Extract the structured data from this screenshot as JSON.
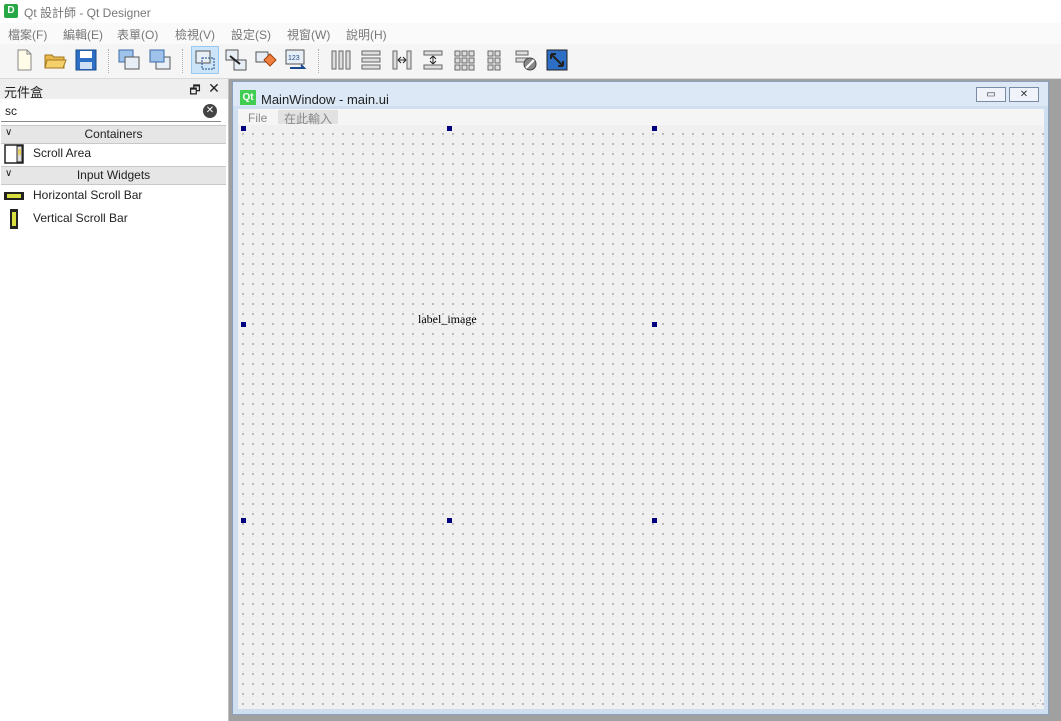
{
  "window": {
    "title": "Qt 設計師 - Qt Designer",
    "app_icon_letter": "D"
  },
  "menubar": [
    {
      "label": "檔案(F)"
    },
    {
      "label": "編輯(E)"
    },
    {
      "label": "表單(O)"
    },
    {
      "label": "檢視(V)"
    },
    {
      "label": "設定(S)"
    },
    {
      "label": "視窗(W)"
    },
    {
      "label": "說明(H)"
    }
  ],
  "toolbar": {
    "icons": [
      "new-file-icon",
      "open-folder-icon",
      "save-icon",
      "send-to-back-icon",
      "bring-to-front-icon",
      "edit-widgets-icon",
      "edit-signals-slots-icon",
      "edit-buddies-icon",
      "edit-tab-order-icon",
      "layout-horizontal-icon",
      "layout-vertical-icon",
      "layout-horizontal-splitter-icon",
      "layout-vertical-splitter-icon",
      "layout-grid-icon",
      "layout-form-icon",
      "break-layout-icon",
      "adjust-size-icon"
    ]
  },
  "widget_box": {
    "title": "元件盒",
    "float_glyph": "🗗",
    "close_glyph": "✕",
    "search": {
      "value": "sc",
      "clear_glyph": "✕"
    },
    "categories": [
      {
        "label": "Containers",
        "items": [
          {
            "label": "Scroll Area"
          }
        ]
      },
      {
        "label": "Input Widgets",
        "items": [
          {
            "label": "Horizontal Scroll Bar"
          },
          {
            "label": "Vertical Scroll Bar"
          }
        ]
      }
    ]
  },
  "form_window": {
    "title": "MainWindow - main.ui",
    "logo_text": "Qt",
    "minimize_glyph": "▭",
    "close_glyph": "✕",
    "menu_file": "File",
    "menu_type_here": "在此輸入",
    "selected_label": "label_image"
  }
}
